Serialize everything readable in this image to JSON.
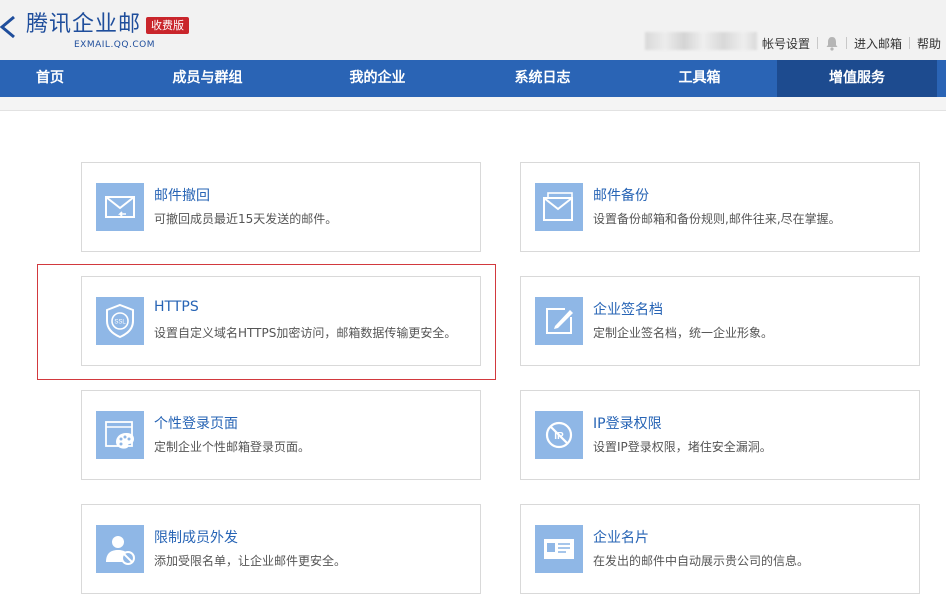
{
  "header": {
    "logo_text": "腾讯企业邮",
    "logo_sub": "EXMAIL.QQ.COM",
    "paid_badge": "收费版",
    "links": {
      "account_settings": "帐号设置",
      "enter_mail": "进入邮箱",
      "help": "帮助"
    }
  },
  "nav": {
    "items": [
      {
        "label": "首页"
      },
      {
        "label": "成员与群组"
      },
      {
        "label": "我的企业"
      },
      {
        "label": "系统日志"
      },
      {
        "label": "工具箱"
      },
      {
        "label": "增值服务",
        "active": true
      }
    ]
  },
  "services": [
    {
      "icon": "mail-recall-icon",
      "title": "邮件撤回",
      "desc": "可撤回成员最近15天发送的邮件。"
    },
    {
      "icon": "mail-backup-icon",
      "title": "邮件备份",
      "desc": "设置备份邮箱和备份规则,邮件往来,尽在掌握。"
    },
    {
      "icon": "ssl-shield-icon",
      "title": "HTTPS",
      "desc": "设置自定义域名HTTPS加密访问，邮箱数据传输更安全。"
    },
    {
      "icon": "signature-pen-icon",
      "title": "企业签名档",
      "desc": "定制企业签名档，统一企业形象。"
    },
    {
      "icon": "palette-icon",
      "title": "个性登录页面",
      "desc": "定制企业个性邮箱登录页面。"
    },
    {
      "icon": "ip-block-icon",
      "title": "IP登录权限",
      "desc": "设置IP登录权限，堵住安全漏洞。"
    },
    {
      "icon": "user-restrict-icon",
      "title": "限制成员外发",
      "desc": "添加受限名单，让企业邮件更安全。"
    },
    {
      "icon": "business-card-icon",
      "title": "企业名片",
      "desc": "在发出的邮件中自动展示贵公司的信息。"
    }
  ],
  "colors": {
    "nav_bg": "#2a64b5",
    "nav_active": "#1d4b8f",
    "brand_blue": "#1f4e9c",
    "badge_red": "#c9252b",
    "icon_bg": "#8fb7e6",
    "link_blue": "#2764b5",
    "highlight": "#d2393e"
  }
}
